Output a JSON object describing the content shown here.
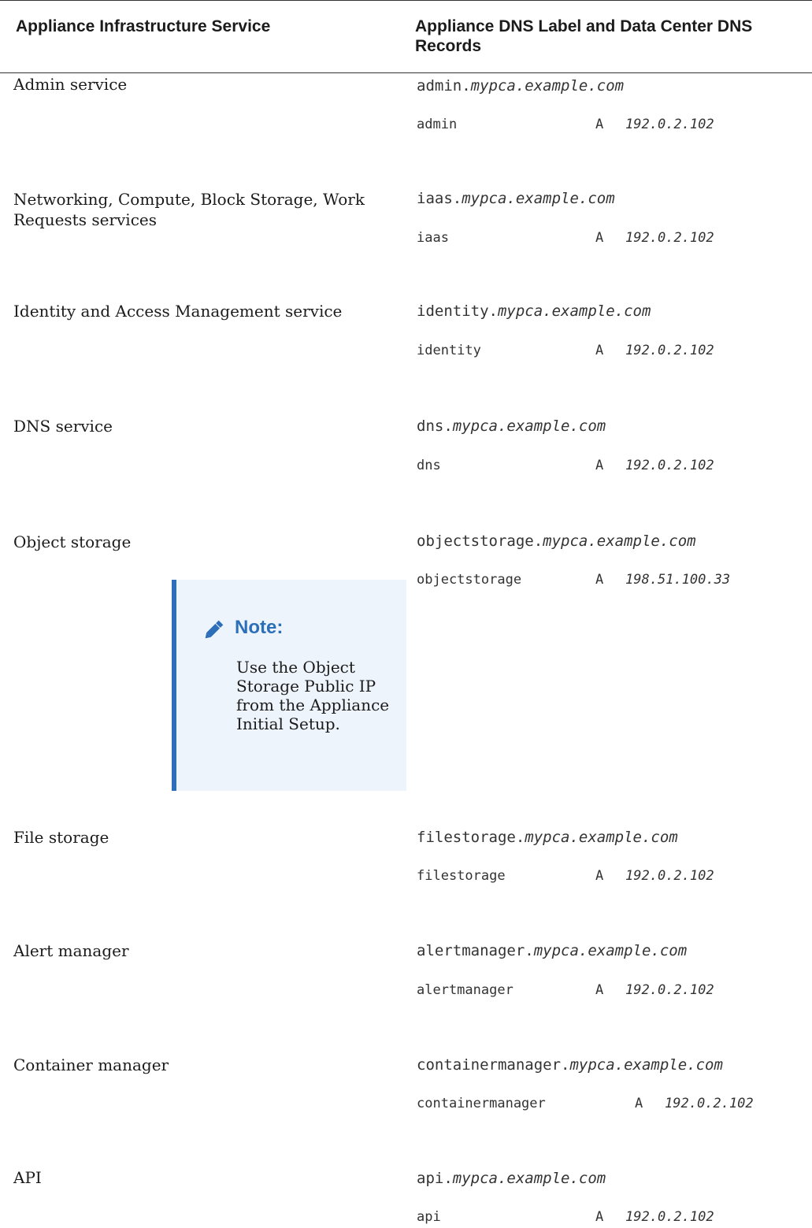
{
  "table": {
    "headers": [
      "Appliance Infrastructure Service",
      "Appliance DNS Label and Data Center DNS Records"
    ],
    "rows": [
      {
        "service": "Admin service",
        "fqdn_label": "admin.",
        "fqdn_domain": "mypca.example.com",
        "record_label": "admin",
        "record_type": "A",
        "record_ip": "192.0.2.102"
      },
      {
        "service": "Networking, Compute, Block Storage, Work Requests services",
        "fqdn_label": "iaas.",
        "fqdn_domain": "mypca.example.com",
        "record_label": "iaas",
        "record_type": "A",
        "record_ip": "192.0.2.102"
      },
      {
        "service": "Identity and Access Management service",
        "fqdn_label": "identity.",
        "fqdn_domain": "mypca.example.com",
        "record_label": "identity",
        "record_type": "A",
        "record_ip": "192.0.2.102"
      },
      {
        "service": "DNS service",
        "fqdn_label": "dns.",
        "fqdn_domain": "mypca.example.com",
        "record_label": "dns",
        "record_type": "A",
        "record_ip": "192.0.2.102"
      },
      {
        "service": "Object storage",
        "fqdn_label": "objectstorage.",
        "fqdn_domain": "mypca.example.com",
        "record_label": "objectstorage",
        "record_type": "A",
        "record_ip": "198.51.100.33"
      },
      {
        "service": "File storage",
        "fqdn_label": "filestorage.",
        "fqdn_domain": "mypca.example.com",
        "record_label": "filestorage",
        "record_type": "A",
        "record_ip": "192.0.2.102"
      },
      {
        "service": "Alert manager",
        "fqdn_label": "alertmanager.",
        "fqdn_domain": "mypca.example.com",
        "record_label": "alertmanager",
        "record_type": "A",
        "record_ip": "192.0.2.102"
      },
      {
        "service": "Container manager",
        "fqdn_label": "containermanager.",
        "fqdn_domain": "mypca.example.com",
        "record_label": "containermanager",
        "record_type": "A",
        "record_ip": "192.0.2.102"
      },
      {
        "service": "API",
        "fqdn_label": "api.",
        "fqdn_domain": "mypca.example.com",
        "record_label": "api",
        "record_type": "A",
        "record_ip": "192.0.2.102"
      }
    ]
  },
  "note": {
    "icon": "pencil-icon",
    "title": "Note:",
    "body": "Use the Object Storage Public IP from the Appliance Initial Setup."
  },
  "colors": {
    "note_accent": "#2c6fb8",
    "note_background": "#eef4fc"
  }
}
